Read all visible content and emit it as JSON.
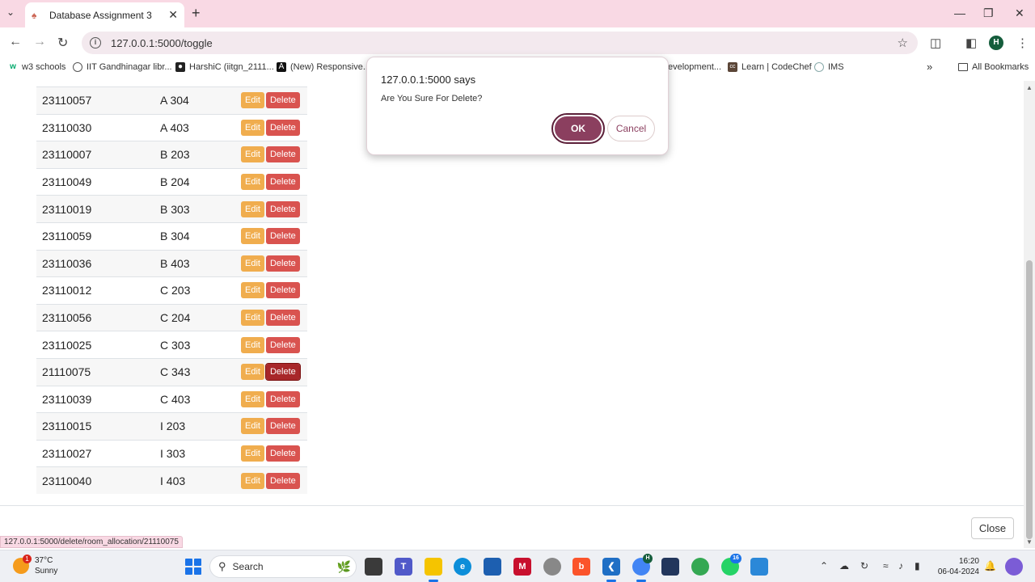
{
  "browser": {
    "tab_title": "Database Assignment 3",
    "url": "127.0.0.1:5000/toggle",
    "avatar_letter": "H",
    "bookmarks": [
      {
        "label": "w3 schools",
        "icon": "w3-icon"
      },
      {
        "label": "IIT Gandhinagar libr...",
        "icon": "globe-icon"
      },
      {
        "label": "HarshiC (iitgn_2111...",
        "icon": "github-icon"
      },
      {
        "label": "(New) Responsive...",
        "icon": "app-icon"
      },
      {
        "label": "evelopment...",
        "icon": ""
      },
      {
        "label": "Learn | CodeChef",
        "icon": "codechef-icon"
      },
      {
        "label": "IMS",
        "icon": "globe-icon"
      }
    ],
    "all_bookmarks": "All Bookmarks"
  },
  "table": {
    "rows": [
      {
        "id": "23110057",
        "room": "A 304"
      },
      {
        "id": "23110030",
        "room": "A 403"
      },
      {
        "id": "23110007",
        "room": "B 203"
      },
      {
        "id": "23110049",
        "room": "B 204"
      },
      {
        "id": "23110019",
        "room": "B 303"
      },
      {
        "id": "23110059",
        "room": "B 304"
      },
      {
        "id": "23110036",
        "room": "B 403"
      },
      {
        "id": "23110012",
        "room": "C 203"
      },
      {
        "id": "23110056",
        "room": "C 204"
      },
      {
        "id": "23110025",
        "room": "C 303"
      },
      {
        "id": "21110075",
        "room": "C 343"
      },
      {
        "id": "23110039",
        "room": "C 403"
      },
      {
        "id": "23110015",
        "room": "I 203"
      },
      {
        "id": "23110027",
        "room": "I 303"
      },
      {
        "id": "23110040",
        "room": "I 403"
      }
    ],
    "edit_label": "Edit",
    "delete_label": "Delete"
  },
  "close_label": "Close",
  "status_url": "127.0.0.1:5000/delete/room_allocation/21110075",
  "dialog": {
    "title": "127.0.0.1:5000 says",
    "message": "Are You Sure For Delete?",
    "ok_label": "OK",
    "cancel_label": "Cancel"
  },
  "taskbar": {
    "weather_temp": "37°C",
    "weather_desc": "Sunny",
    "weather_badge": "1",
    "search_placeholder": "Search",
    "time": "16:20",
    "date": "06-04-2024",
    "chrome_badge": "H",
    "whatsapp_badge": "16"
  }
}
